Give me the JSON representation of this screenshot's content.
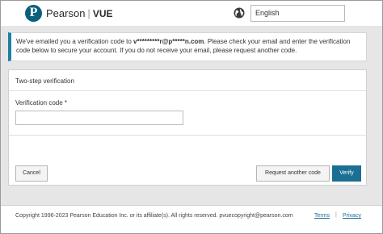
{
  "header": {
    "logo_letter": "P",
    "brand_name": "Pearson",
    "brand_separator": "|",
    "brand_product": "VUE",
    "language_icon": "globe-icon",
    "language_selected": "English"
  },
  "alert": {
    "text_before": "We've emailed you a verification code to ",
    "email": "v*********r@p*****n.com",
    "text_after": ". Please check your email and enter the verification code below to secure your account. If you do not receive your email, please request another code."
  },
  "card": {
    "title": "Two-step verification",
    "field_label": "Verification code *",
    "field_value": "",
    "cancel_label": "Cancel",
    "request_label": "Request another code",
    "verify_label": "Verify"
  },
  "footer": {
    "copyright": "Copyright 1996-2023 Pearson Education Inc. or its affiliate(s). All rights reserved. pvuecopyright@pearson.com",
    "terms_label": "Terms",
    "separator": "|",
    "privacy_label": "Privacy"
  },
  "colors": {
    "brand": "#0a5f7d",
    "accent": "#1b6f93",
    "background": "#e6e6e6"
  }
}
